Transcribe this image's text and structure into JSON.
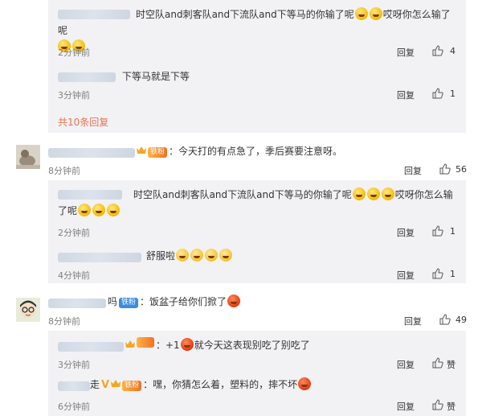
{
  "labels": {
    "reply": "回复",
    "like": "赞"
  },
  "colors": {
    "link": "#eb7350",
    "meta": "#808080",
    "subbg": "#f2f2f5",
    "badge_fan": "#f37021",
    "badge_blue": "#3b8de0"
  },
  "thread1": {
    "reply1": {
      "text_a": "时空队and刺客队and下流队and下等马的你输了呢",
      "text_b": "哎呀你怎么输了呢",
      "time": "2分钟前",
      "likes": "4"
    },
    "reply2": {
      "text": "下等马就是下等",
      "time": "3分钟前",
      "likes": "1"
    },
    "more": "共10条回复"
  },
  "comment2": {
    "badge": "铁粉",
    "text": "：今天打的有点急了，季后赛要注意呀。",
    "time": "8分钟前",
    "likes": "56",
    "reply1": {
      "text_a": "时空队and刺客队and下流队and下等马的你输了呢",
      "text_b": "哎呀你怎么输",
      "text_c": "了呢",
      "time": "2分钟前",
      "likes": "1"
    },
    "reply2": {
      "text": "舒服啦",
      "time": "4分钟前",
      "likes": "1"
    }
  },
  "comment3": {
    "name_tail": "吗",
    "badge": "铁粉",
    "text": "：饭盆子给你们掀了",
    "time": "8分钟前",
    "likes": "49",
    "reply1": {
      "text_a": "：+1",
      "text_b": "就今天这表现别吃了别吃了",
      "time": "3分钟前"
    },
    "reply2": {
      "name_tail": "走",
      "badge": "铁粉",
      "text_a": "：嘿，你猜怎么着，塑料的，摔不坏",
      "time": "6分钟前"
    }
  }
}
